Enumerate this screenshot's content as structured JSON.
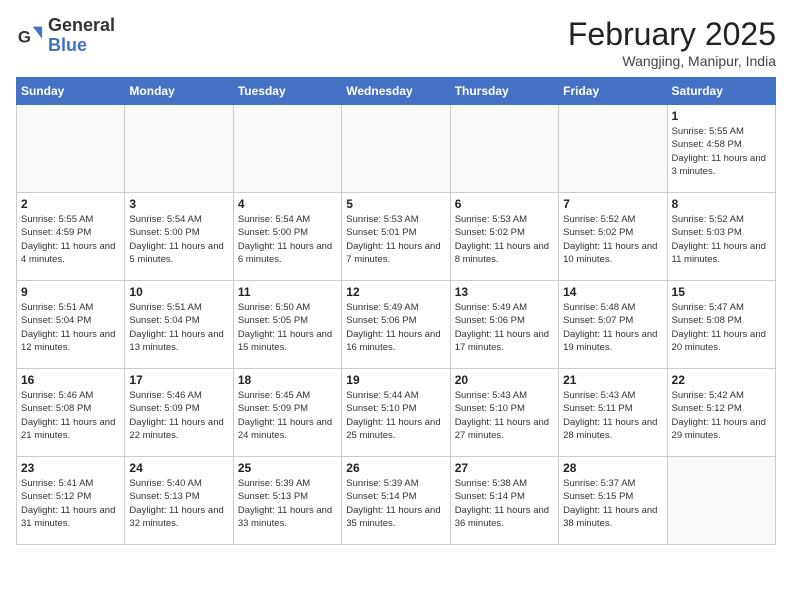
{
  "header": {
    "logo_general": "General",
    "logo_blue": "Blue",
    "month_title": "February 2025",
    "location": "Wangjing, Manipur, India"
  },
  "weekdays": [
    "Sunday",
    "Monday",
    "Tuesday",
    "Wednesday",
    "Thursday",
    "Friday",
    "Saturday"
  ],
  "weeks": [
    [
      {
        "day": "",
        "info": ""
      },
      {
        "day": "",
        "info": ""
      },
      {
        "day": "",
        "info": ""
      },
      {
        "day": "",
        "info": ""
      },
      {
        "day": "",
        "info": ""
      },
      {
        "day": "",
        "info": ""
      },
      {
        "day": "1",
        "info": "Sunrise: 5:55 AM\nSunset: 4:58 PM\nDaylight: 11 hours\nand 3 minutes."
      }
    ],
    [
      {
        "day": "2",
        "info": "Sunrise: 5:55 AM\nSunset: 4:59 PM\nDaylight: 11 hours\nand 4 minutes."
      },
      {
        "day": "3",
        "info": "Sunrise: 5:54 AM\nSunset: 5:00 PM\nDaylight: 11 hours\nand 5 minutes."
      },
      {
        "day": "4",
        "info": "Sunrise: 5:54 AM\nSunset: 5:00 PM\nDaylight: 11 hours\nand 6 minutes."
      },
      {
        "day": "5",
        "info": "Sunrise: 5:53 AM\nSunset: 5:01 PM\nDaylight: 11 hours\nand 7 minutes."
      },
      {
        "day": "6",
        "info": "Sunrise: 5:53 AM\nSunset: 5:02 PM\nDaylight: 11 hours\nand 8 minutes."
      },
      {
        "day": "7",
        "info": "Sunrise: 5:52 AM\nSunset: 5:02 PM\nDaylight: 11 hours\nand 10 minutes."
      },
      {
        "day": "8",
        "info": "Sunrise: 5:52 AM\nSunset: 5:03 PM\nDaylight: 11 hours\nand 11 minutes."
      }
    ],
    [
      {
        "day": "9",
        "info": "Sunrise: 5:51 AM\nSunset: 5:04 PM\nDaylight: 11 hours\nand 12 minutes."
      },
      {
        "day": "10",
        "info": "Sunrise: 5:51 AM\nSunset: 5:04 PM\nDaylight: 11 hours\nand 13 minutes."
      },
      {
        "day": "11",
        "info": "Sunrise: 5:50 AM\nSunset: 5:05 PM\nDaylight: 11 hours\nand 15 minutes."
      },
      {
        "day": "12",
        "info": "Sunrise: 5:49 AM\nSunset: 5:06 PM\nDaylight: 11 hours\nand 16 minutes."
      },
      {
        "day": "13",
        "info": "Sunrise: 5:49 AM\nSunset: 5:06 PM\nDaylight: 11 hours\nand 17 minutes."
      },
      {
        "day": "14",
        "info": "Sunrise: 5:48 AM\nSunset: 5:07 PM\nDaylight: 11 hours\nand 19 minutes."
      },
      {
        "day": "15",
        "info": "Sunrise: 5:47 AM\nSunset: 5:08 PM\nDaylight: 11 hours\nand 20 minutes."
      }
    ],
    [
      {
        "day": "16",
        "info": "Sunrise: 5:46 AM\nSunset: 5:08 PM\nDaylight: 11 hours\nand 21 minutes."
      },
      {
        "day": "17",
        "info": "Sunrise: 5:46 AM\nSunset: 5:09 PM\nDaylight: 11 hours\nand 22 minutes."
      },
      {
        "day": "18",
        "info": "Sunrise: 5:45 AM\nSunset: 5:09 PM\nDaylight: 11 hours\nand 24 minutes."
      },
      {
        "day": "19",
        "info": "Sunrise: 5:44 AM\nSunset: 5:10 PM\nDaylight: 11 hours\nand 25 minutes."
      },
      {
        "day": "20",
        "info": "Sunrise: 5:43 AM\nSunset: 5:10 PM\nDaylight: 11 hours\nand 27 minutes."
      },
      {
        "day": "21",
        "info": "Sunrise: 5:43 AM\nSunset: 5:11 PM\nDaylight: 11 hours\nand 28 minutes."
      },
      {
        "day": "22",
        "info": "Sunrise: 5:42 AM\nSunset: 5:12 PM\nDaylight: 11 hours\nand 29 minutes."
      }
    ],
    [
      {
        "day": "23",
        "info": "Sunrise: 5:41 AM\nSunset: 5:12 PM\nDaylight: 11 hours\nand 31 minutes."
      },
      {
        "day": "24",
        "info": "Sunrise: 5:40 AM\nSunset: 5:13 PM\nDaylight: 11 hours\nand 32 minutes."
      },
      {
        "day": "25",
        "info": "Sunrise: 5:39 AM\nSunset: 5:13 PM\nDaylight: 11 hours\nand 33 minutes."
      },
      {
        "day": "26",
        "info": "Sunrise: 5:39 AM\nSunset: 5:14 PM\nDaylight: 11 hours\nand 35 minutes."
      },
      {
        "day": "27",
        "info": "Sunrise: 5:38 AM\nSunset: 5:14 PM\nDaylight: 11 hours\nand 36 minutes."
      },
      {
        "day": "28",
        "info": "Sunrise: 5:37 AM\nSunset: 5:15 PM\nDaylight: 11 hours\nand 38 minutes."
      },
      {
        "day": "",
        "info": ""
      }
    ]
  ]
}
